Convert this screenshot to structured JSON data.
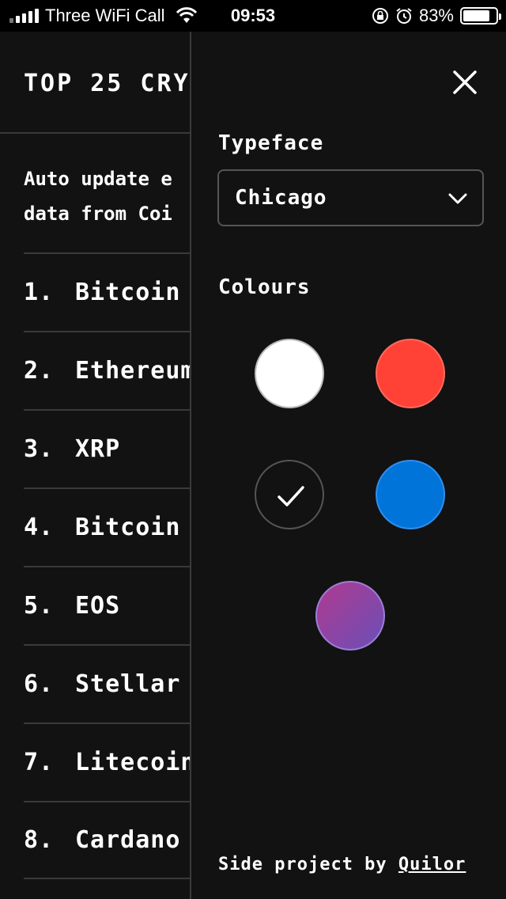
{
  "status": {
    "carrier": "Three WiFi Call",
    "time": "09:53",
    "battery_percent_text": "83%",
    "battery_level": 0.83
  },
  "list": {
    "header": "TOP 25 CRY",
    "description_line1": "Auto update e",
    "description_line2": "data from Coi",
    "rows": [
      {
        "num": "1.",
        "name": "Bitcoin"
      },
      {
        "num": "2.",
        "name": "Ethereum"
      },
      {
        "num": "3.",
        "name": "XRP"
      },
      {
        "num": "4.",
        "name": "Bitcoin C"
      },
      {
        "num": "5.",
        "name": "EOS"
      },
      {
        "num": "6.",
        "name": "Stellar"
      },
      {
        "num": "7.",
        "name": "Litecoin"
      },
      {
        "num": "8.",
        "name": "Cardano"
      }
    ]
  },
  "settings": {
    "typeface_label": "Typeface",
    "typeface_value": "Chicago",
    "colours_label": "Colours",
    "colours": {
      "white": "#ffffff",
      "red": "#ff4136",
      "dark": "#121212",
      "blue": "#0074d9",
      "gradient_start": "#b03a8f",
      "gradient_end": "#6a4fb8"
    },
    "selected_colour": "dark",
    "credit_prefix": "Side project by ",
    "credit_link": "Quilor"
  }
}
